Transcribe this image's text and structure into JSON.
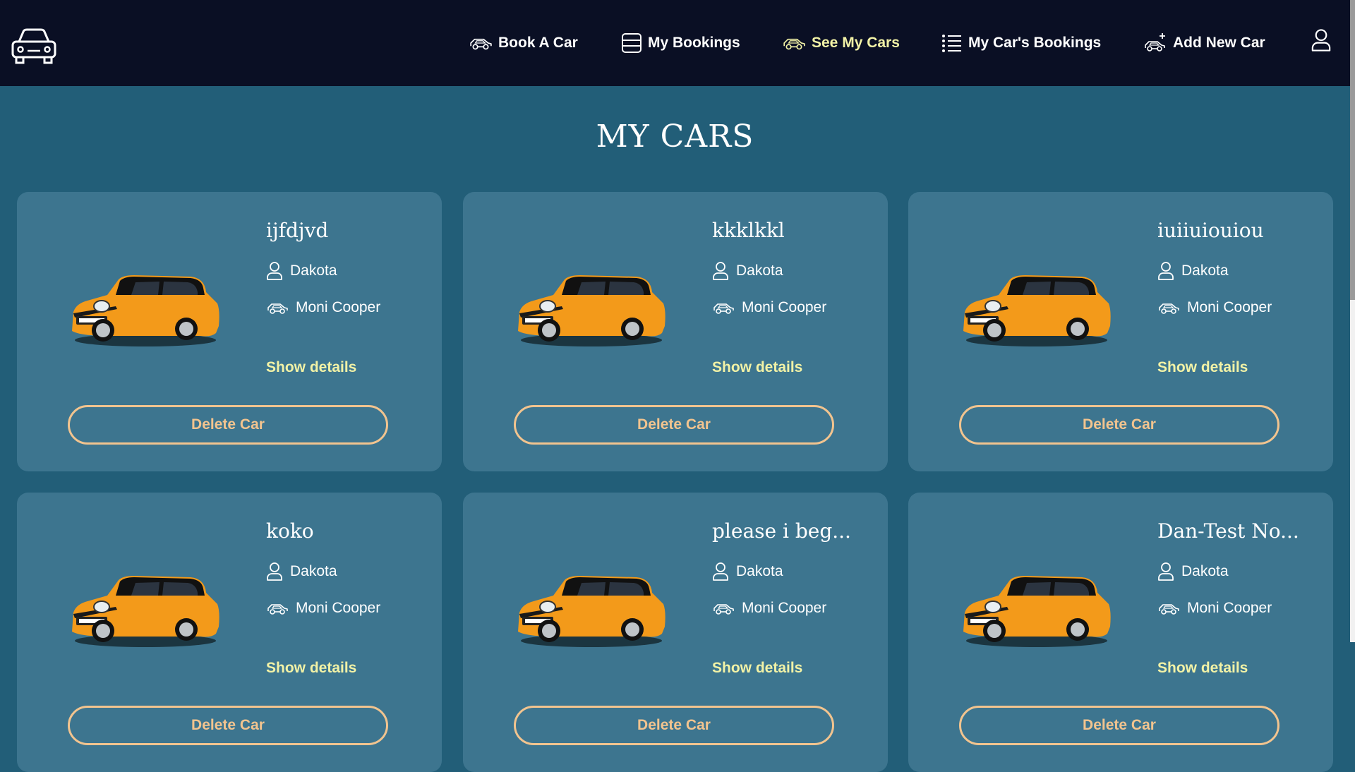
{
  "nav": {
    "book_a_car": "Book A Car",
    "my_bookings": "My Bookings",
    "see_my_cars": "See My Cars",
    "my_cars_bookings": "My Car's Bookings",
    "add_new_car": "Add New Car"
  },
  "page": {
    "title": "MY CARS"
  },
  "cars": [
    {
      "name": "ijfdjvd",
      "owner": "Dakota",
      "model": "Moni Cooper",
      "details_label": "Show details",
      "delete_label": "Delete Car"
    },
    {
      "name": "kkklkkl",
      "owner": "Dakota",
      "model": "Moni Cooper",
      "details_label": "Show details",
      "delete_label": "Delete Car"
    },
    {
      "name": "iuiiuiouiou",
      "owner": "Dakota",
      "model": "Moni Cooper",
      "details_label": "Show details",
      "delete_label": "Delete Car"
    },
    {
      "name": "koko",
      "owner": "Dakota",
      "model": "Moni Cooper",
      "details_label": "Show details",
      "delete_label": "Delete Car"
    },
    {
      "name": "please i beg...",
      "owner": "Dakota",
      "model": "Moni Cooper",
      "details_label": "Show details",
      "delete_label": "Delete Car"
    },
    {
      "name": "Dan-Test No...",
      "owner": "Dakota",
      "model": "Moni Cooper",
      "details_label": "Show details",
      "delete_label": "Delete Car"
    }
  ],
  "colors": {
    "nav_bg": "#0a0f24",
    "page_bg": "#225e78",
    "card_bg": "#3d758f",
    "active_accent": "#f2f2a6",
    "delete_accent": "#f2c48f",
    "car_body": "#f39a1a"
  },
  "icons": {
    "logo": "car-front-icon",
    "book_a_car": "car-side-icon",
    "my_bookings": "list-box-icon",
    "see_my_cars": "car-side-icon",
    "my_cars_bookings": "list-bullets-icon",
    "add_new_car": "car-plus-icon",
    "profile": "user-icon",
    "owner": "user-icon",
    "model": "car-side-icon"
  }
}
